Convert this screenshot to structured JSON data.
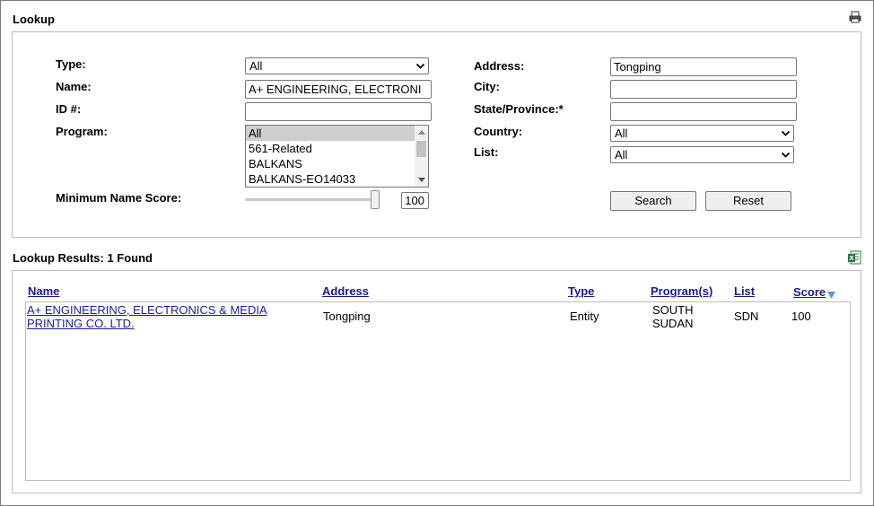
{
  "lookup": {
    "title": "Lookup",
    "fields": {
      "type_label": "Type:",
      "type_value": "All",
      "name_label": "Name:",
      "name_value": "A+ ENGINEERING, ELECTRONI",
      "id_label": "ID #:",
      "id_value": "",
      "program_label": "Program:",
      "program_options": [
        "All",
        "561-Related",
        "BALKANS",
        "BALKANS-EO14033"
      ],
      "min_score_label": "Minimum Name Score:",
      "min_score_value": "100",
      "min_score_fraction": 1.0,
      "address_label": "Address:",
      "address_value": "Tongping",
      "city_label": "City:",
      "city_value": "",
      "state_label": "State/Province:*",
      "state_value": "",
      "country_label": "Country:",
      "country_value": "All",
      "list_label": "List:",
      "list_value": "All"
    },
    "buttons": {
      "search": "Search",
      "reset": "Reset"
    }
  },
  "results": {
    "title": "Lookup Results: 1 Found",
    "columns": {
      "name": "Name",
      "address": "Address",
      "type": "Type",
      "programs": "Program(s)",
      "list": "List",
      "score": "Score"
    },
    "rows": [
      {
        "name_line1": "A+ ENGINEERING, ELECTRONICS & MEDIA",
        "name_line2": "PRINTING CO. LTD.",
        "address": "Tongping",
        "type": "Entity",
        "program_line1": "SOUTH",
        "program_line2": "SUDAN",
        "list": "SDN",
        "score": "100"
      }
    ]
  },
  "icons": {
    "print": "printer-icon",
    "excel": "excel-export-icon",
    "sort": "sort-descending-icon"
  },
  "colors": {
    "link": "#1a1aa6",
    "header_link": "#1a1a8c",
    "sort_arrow": "#5b9bd5",
    "excel_green": "#1d7a3e"
  }
}
